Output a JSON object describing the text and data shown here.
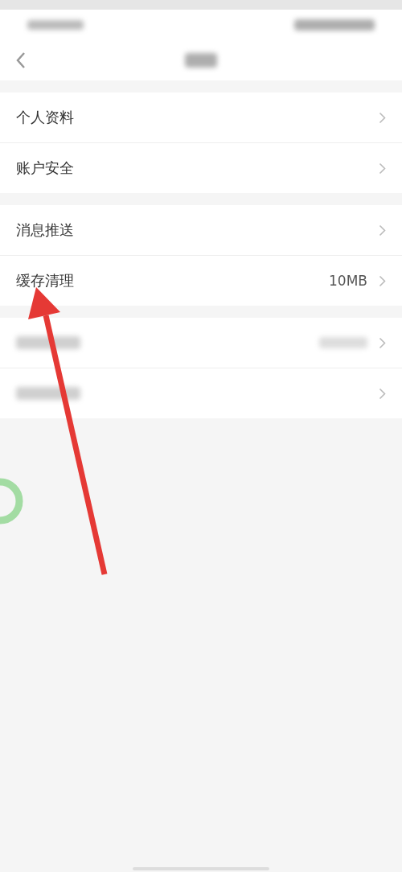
{
  "groups": [
    {
      "rows": [
        {
          "kind": "text",
          "label": "个人资料"
        },
        {
          "kind": "text",
          "label": "账户安全"
        }
      ]
    },
    {
      "rows": [
        {
          "kind": "text",
          "label": "消息推送"
        },
        {
          "kind": "text",
          "label": "缓存清理",
          "value": "10MB"
        }
      ]
    },
    {
      "rows": [
        {
          "kind": "blurred",
          "has_value": true
        },
        {
          "kind": "blurred",
          "has_value": false
        }
      ]
    }
  ]
}
